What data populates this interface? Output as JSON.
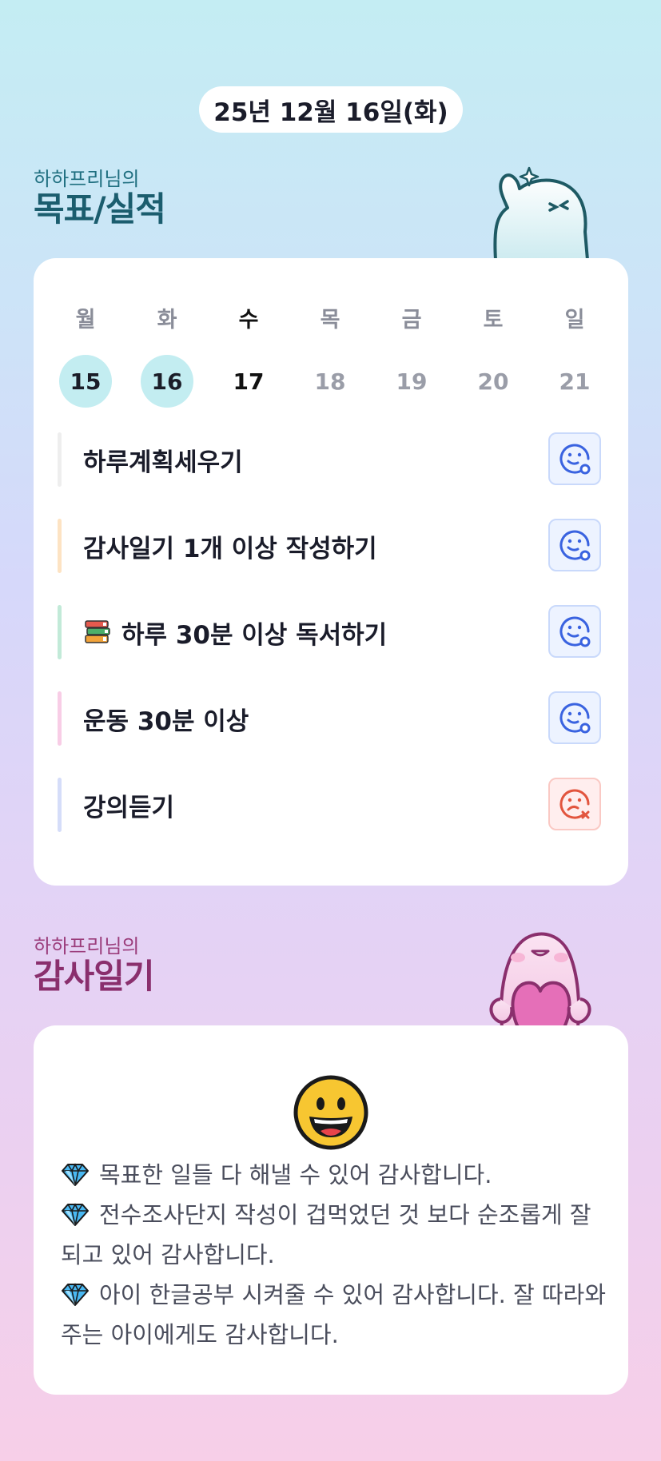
{
  "header": {
    "date": "25년 12월 16일(화)"
  },
  "goals_section": {
    "subtitle": "하하프리님의",
    "title": "목표/실적",
    "week": [
      {
        "day": "월",
        "date": "15",
        "state": "done"
      },
      {
        "day": "화",
        "date": "16",
        "state": "done"
      },
      {
        "day": "수",
        "date": "17",
        "state": "today"
      },
      {
        "day": "목",
        "date": "18",
        "state": "future"
      },
      {
        "day": "금",
        "date": "19",
        "state": "future"
      },
      {
        "day": "토",
        "date": "20",
        "state": "future"
      },
      {
        "day": "일",
        "date": "21",
        "state": "future"
      }
    ],
    "goals": [
      {
        "label": "하루계획세우기",
        "bar_color": "#eeeeee",
        "status": "achieved",
        "icon": "smile-check-icon"
      },
      {
        "label": "감사일기 1개 이상 작성하기",
        "bar_color": "#fde3c3",
        "status": "achieved",
        "icon": "smile-check-icon"
      },
      {
        "label": "하루 30분 이상 독서하기",
        "prefix_icon": "books-icon",
        "bar_color": "#c2ead8",
        "status": "achieved",
        "icon": "smile-check-icon"
      },
      {
        "label": "운동 30분 이상",
        "bar_color": "#f8cde6",
        "status": "achieved",
        "icon": "smile-check-icon"
      },
      {
        "label": "강의듣기",
        "bar_color": "#d5ddf9",
        "status": "missed",
        "icon": "sad-x-icon"
      }
    ]
  },
  "thanks_section": {
    "subtitle": "하하프리님의",
    "title": "감사일기",
    "mood_icon": "grinning-face-icon",
    "entries": [
      "목표한 일들 다 해낼 수 있어 감사합니다.",
      "전수조사단지 작성이 겁먹었던 것 보다 순조롭게 잘 되고 있어 감사합니다.",
      "아이 한글공부 시켜줄 수 있어 감사합니다. 잘 따라와주는 아이에게도 감사합니다."
    ],
    "bullet_icon": "gem-icon"
  },
  "colors": {
    "ok_icon": "#3a63e0",
    "fail_icon": "#e2553e",
    "done_day_bg": "#c3edf1"
  }
}
